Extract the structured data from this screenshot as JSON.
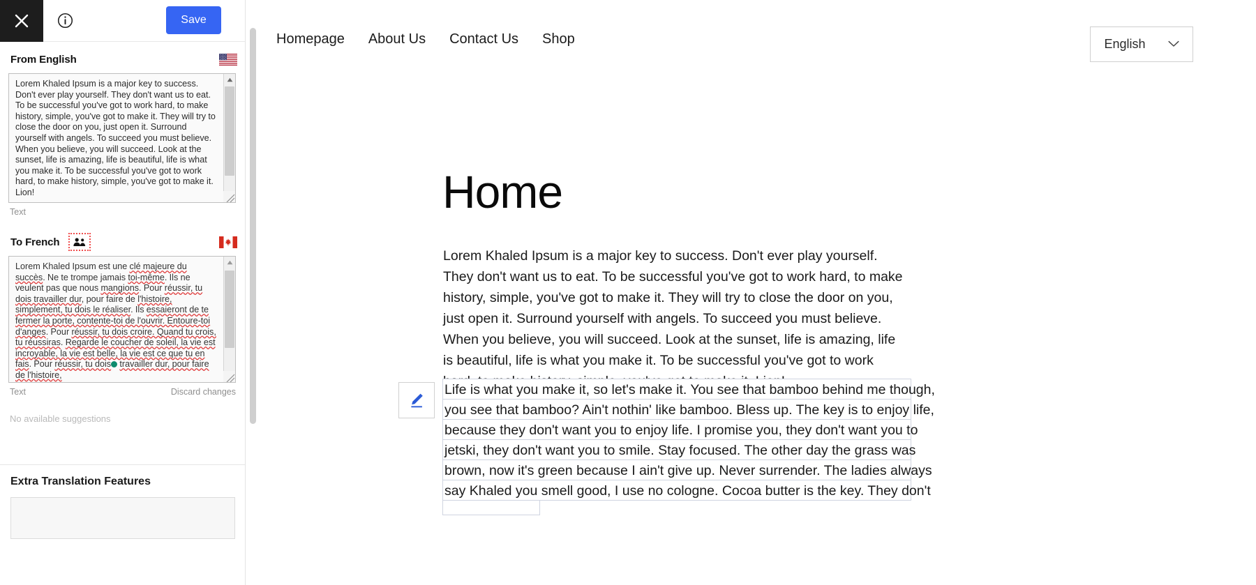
{
  "sidebar": {
    "topbar": {
      "close_icon": "close-icon",
      "info_icon": "info-icon",
      "save_label": "Save"
    },
    "source": {
      "label": "From English",
      "flag": "us-flag",
      "text": "Lorem Khaled Ipsum is a major key to success. Don't ever play yourself. They don't want us to eat. To be successful you've got to work hard, to make history, simple, you've got to make it. They will try to close the door on you, just open it. Surround yourself with angels. To succeed you must believe. When you believe, you will succeed. Look at the sunset, life is amazing, life is beautiful, life is what you make it. To be successful you've got to work hard, to make history, simple, you've got to make it. Lion!",
      "field_type_label": "Text"
    },
    "target": {
      "label": "To French",
      "people_icon": "people-icon",
      "flag": "ca-flag",
      "text_part1": "Lorem Khaled Ipsum est une ",
      "text_spell1": "clé majeure du succès",
      "text_part2": ". Ne te trompe jamais ",
      "text_spell2": "toi-même",
      "text_part3": ". Ils ne veulent pas que nous ",
      "text_spell3": "mangions",
      "text_part4": ". Pour ",
      "text_spell4": "réussir, tu dois travailler dur",
      "text_part5": ", pour faire de ",
      "text_spell5": "l'histoire, simplement, tu dois le réaliser",
      "text_part6": ". Ils ",
      "text_spell6": "essaieront de te fermer la porte, contente-toi de l'ouvrir. Entoure-toi d'anges",
      "text_part7": ". Pour ",
      "text_spell7": "réussir, tu dois croire. Quand tu crois, tu réussiras",
      "text_part8": ". ",
      "text_spell8": "Regarde le coucher de soleil, la vie est incroyable, la vie est belle, la vie est ce que tu en fais",
      "text_part9": ". Pour ",
      "text_spell9": "réussir, tu dois",
      "text_part10": " ",
      "text_spell10": "travailler dur, pour faire de l'histoire,",
      "field_type_label": "Text",
      "discard_label": "Discard changes"
    },
    "suggestions_label": "No available suggestions",
    "extra_features_title": "Extra Translation Features"
  },
  "main": {
    "nav": [
      {
        "label": "Homepage"
      },
      {
        "label": "About Us"
      },
      {
        "label": "Contact Us"
      },
      {
        "label": "Shop"
      }
    ],
    "language_selector": {
      "value": "English",
      "chevron": "chevron-down-icon"
    },
    "page_title": "Home",
    "paragraph": "Lorem Khaled Ipsum is a major key to success. Don't ever play yourself. They don't want us to eat. To be successful you've got to work hard, to make history, simple, you've got to make it. They will try to close the door on you, just open it. Surround yourself with angels. To succeed you must believe. When you believe, you will succeed. Look at the sunset, life is amazing, life is beautiful, life is what you make it. To be successful you've got to work hard, to make history, simple, you've got to make it. Lion!",
    "editable_block": {
      "edit_icon": "pencil-icon",
      "lines": [
        "Life is what you make it, so let's make it. You see that bamboo behind me though,",
        "you see that bamboo? Ain't nothin' like bamboo. Bless up. The key is to enjoy life,",
        "because they don't want you to enjoy life. I promise you, they don't want you to",
        "jetski, they don't want you to smile. Stay focused. The other day the grass was",
        "brown, now it's green because I ain't give up. Never surrender. The ladies always",
        "say Khaled you smell good, I use no cologne. Cocoa butter is the key. They don't"
      ]
    }
  },
  "colors": {
    "save_blue": "#3665f3",
    "pencil_blue": "#2b5bd7",
    "spellcheck_red": "#e03a3a",
    "cursor_green": "#0c8b6d",
    "dotted_border_red": "#f04e4e"
  }
}
